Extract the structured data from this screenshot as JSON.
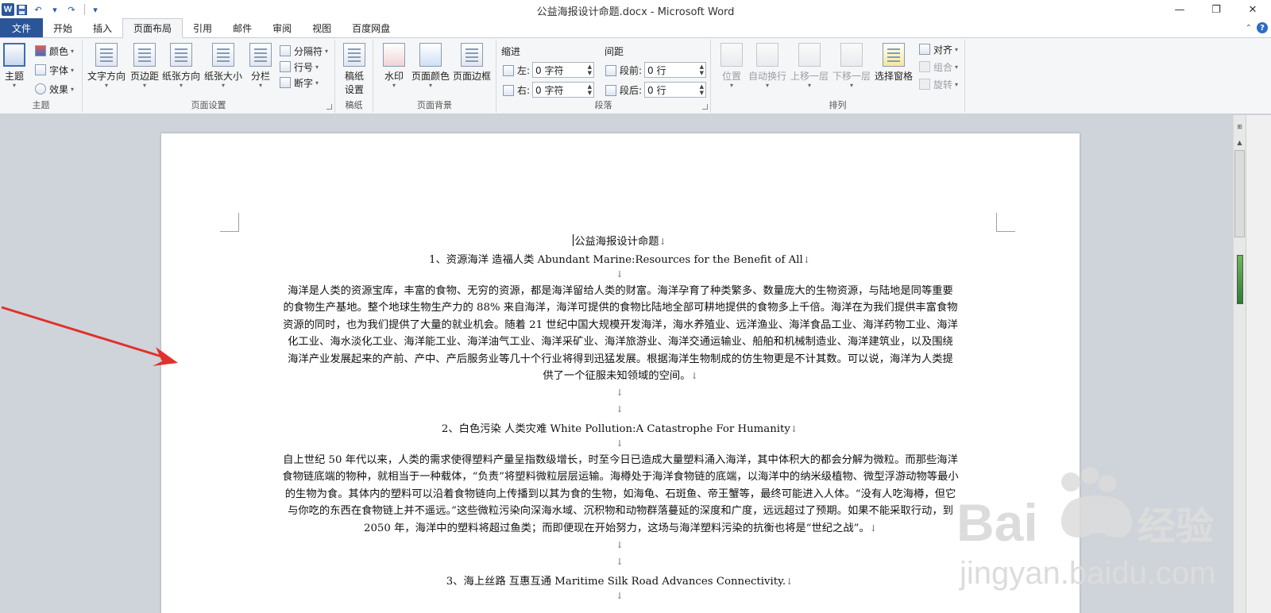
{
  "window": {
    "title": "公益海报设计命题.docx - Microsoft Word",
    "min": "—",
    "max": "❐",
    "close": "✕"
  },
  "qat": {
    "logo": "W",
    "save": "💾",
    "undo": "↶",
    "redo": "↷",
    "customize": "▾"
  },
  "tabs": [
    {
      "label": "文件"
    },
    {
      "label": "开始"
    },
    {
      "label": "插入"
    },
    {
      "label": "页面布局"
    },
    {
      "label": "引用"
    },
    {
      "label": "邮件"
    },
    {
      "label": "审阅"
    },
    {
      "label": "视图"
    },
    {
      "label": "百度网盘"
    }
  ],
  "ribbon": {
    "theme_group": {
      "label": "主题",
      "theme": "主题",
      "colors": "颜色",
      "fonts": "字体",
      "effects": "效果"
    },
    "page_setup": {
      "label": "页面设置",
      "text_direction": "文字方向",
      "margins": "页边距",
      "orientation": "纸张方向",
      "size": "纸张大小",
      "columns": "分栏",
      "breaks": "分隔符",
      "line_numbers": "行号",
      "hyphenation": "断字"
    },
    "draft": {
      "label": "稿纸",
      "button_line1": "稿纸",
      "button_line2": "设置"
    },
    "page_bg": {
      "label": "页面背景",
      "watermark": "水印",
      "page_color": "页面颜色",
      "page_border": "页面边框"
    },
    "paragraph": {
      "label": "段落",
      "indent": "缩进",
      "spacing": "间距",
      "left": "左:",
      "right": "右:",
      "before": "段前:",
      "after": "段后:",
      "left_val": "0 字符",
      "right_val": "0 字符",
      "before_val": "0 行",
      "after_val": "0 行"
    },
    "arrange": {
      "label": "排列",
      "position": "位置",
      "wrap": "自动换行",
      "bring_forward": "上移一层",
      "send_backward": "下移一层",
      "selection_pane": "选择窗格",
      "align": "对齐",
      "group": "组合",
      "rotate": "旋转"
    }
  },
  "document": {
    "title": "公益海报设计命题",
    "h1": "1、资源海洋 造福人类 Abundant Marine:Resources for the Benefit of All",
    "p1": [
      "海洋是人类的资源宝库，丰富的食物、无穷的资源，都是海洋留给人类的财富。海洋孕育了种类繁多、数量庞大的生物资源，与陆地是同等重要",
      "的食物生产基地。整个地球生物生产力的 88% 来自海洋，海洋可提供的食物比陆地全部可耕地提供的食物多上千倍。海洋在为我们提供丰富食物",
      "资源的同时，也为我们提供了大量的就业机会。随着 21 世纪中国大规模开发海洋，海水养殖业、远洋渔业、海洋食品工业、海洋药物工业、海洋",
      "化工业、海水淡化工业、海洋能工业、海洋油气工业、海洋采矿业、海洋旅游业、海洋交通运输业、船舶和机械制造业、海洋建筑业，以及围绕",
      "海洋产业发展起来的产前、产中、产后服务业等几十个行业将得到迅猛发展。根据海洋生物制成的仿生物更是不计其数。可以说，海洋为人类提",
      "供了一个征服未知领域的空间。"
    ],
    "h2": "2、白色污染  人类灾难 White Pollution:A Catastrophe For Humanity",
    "p2": [
      "自上世纪 50 年代以来，人类的需求使得塑料产量呈指数级增长，时至今日已造成大量塑料涌入海洋，其中体积大的都会分解为微粒。而那些海洋",
      "食物链底端的物种，就相当于一种载体，“负责”将塑料微粒层层运输。海樽处于海洋食物链的底端，以海洋中的纳米级植物、微型浮游动物等最小",
      "的生物为食。其体内的塑料可以沿着食物链向上传播到以其为食的生物，如海龟、石斑鱼、帝王蟹等，最终可能进入人体。“没有人吃海樽，但它",
      "与你吃的东西在食物链上并不遥远。”这些微粒污染向深海水域、沉积物和动物群落蔓延的深度和广度，远远超过了预期。如果不能采取行动，到",
      "2050 年，海洋中的塑料将超过鱼类；而即便现在开始努力，这场与海洋塑料污染的抗衡也将是“世纪之战”。"
    ],
    "h3": "3、海上丝路  互惠互通 Maritime Silk Road Advances Connectivity.",
    "para_mark": "↓"
  },
  "watermark": {
    "brand": "Bai",
    "brand2": "经验",
    "url": "jingyan.baidu.com"
  },
  "colors": {
    "accent": "#2b579a",
    "arrow": "#e0312c"
  }
}
